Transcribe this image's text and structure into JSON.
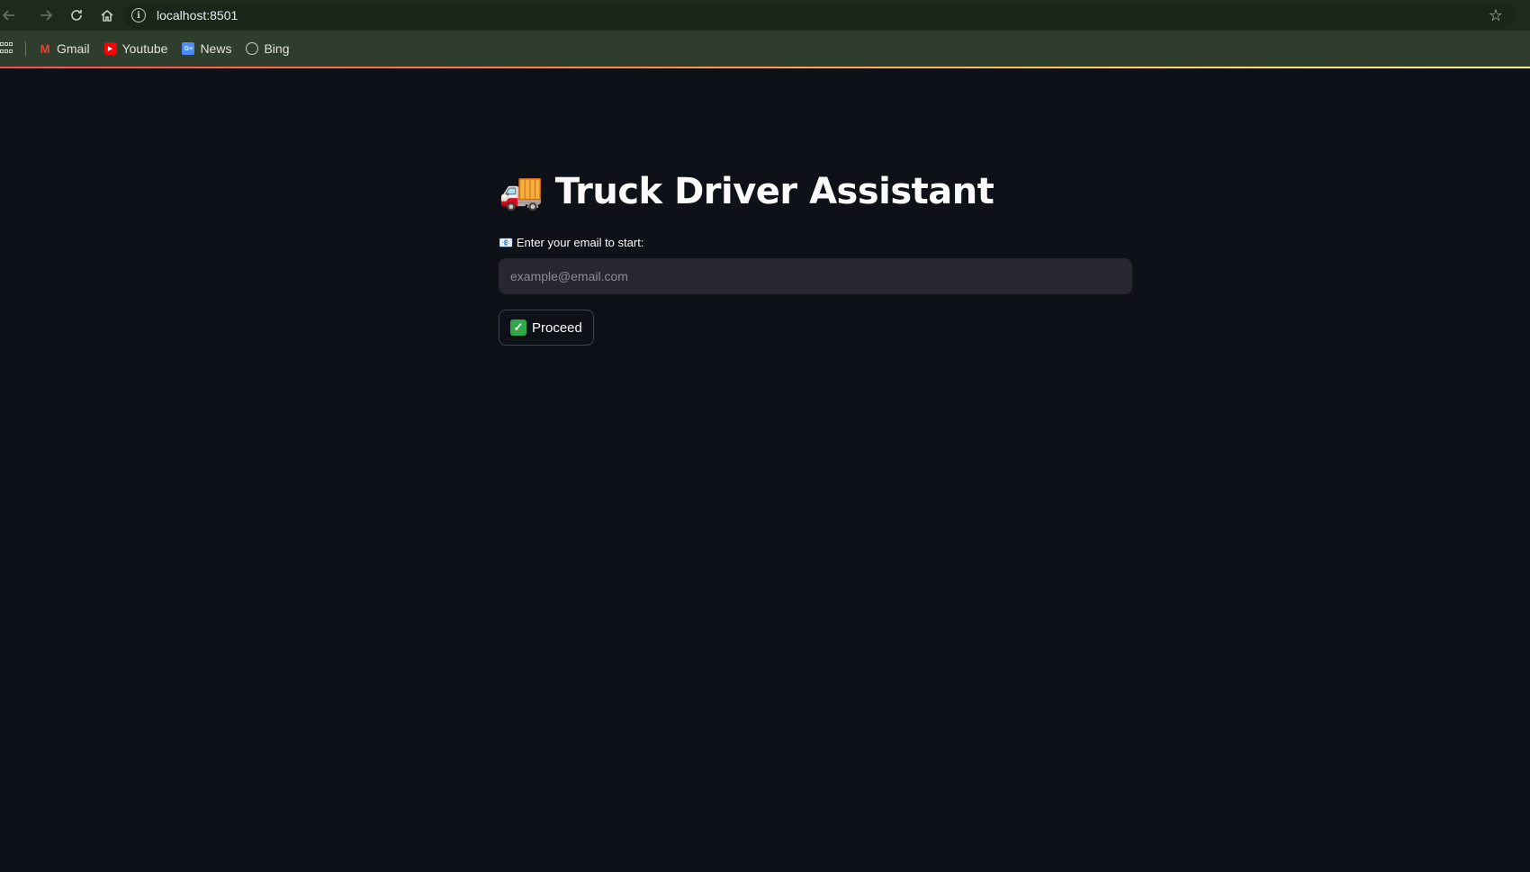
{
  "browser": {
    "url": "localhost:8501",
    "bookmarks": [
      {
        "label": "Gmail",
        "icon": "gmail-icon"
      },
      {
        "label": "Youtube",
        "icon": "youtube-icon"
      },
      {
        "label": "News",
        "icon": "news-icon"
      },
      {
        "label": "Bing",
        "icon": "bing-icon"
      }
    ]
  },
  "app": {
    "title_emoji": "🚚",
    "title": "Truck Driver Assistant",
    "email_label_emoji": "📧",
    "email_label": "Enter your email to start:",
    "email_placeholder": "example@email.com",
    "email_value": "",
    "proceed_label": "Proceed",
    "proceed_icon": "✅"
  },
  "colors": {
    "background": "#0e1117",
    "input_background": "#262730",
    "text": "#fafafa",
    "accent_gradient": [
      "#ff4b4b",
      "#fffd80"
    ]
  }
}
